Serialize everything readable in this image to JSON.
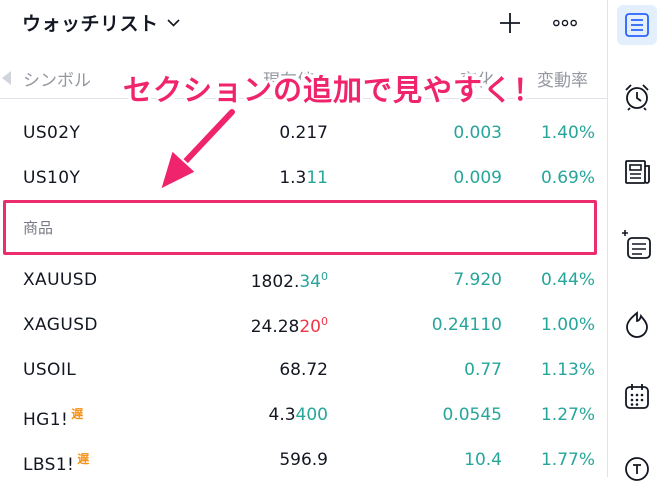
{
  "header": {
    "title": "ウォッチリスト",
    "icons": [
      "chevron-down-icon",
      "plus-icon",
      "more-dots-icon"
    ]
  },
  "columns": {
    "symbol": "シンボル",
    "last": "現在値",
    "change": "変化",
    "change_pct": "変動率"
  },
  "annotation": {
    "callout": "セクションの追加で見やすく！",
    "color": "#f0246c"
  },
  "rows_top": [
    {
      "symbol": "US02Y",
      "last": "0.217",
      "last_hi": "",
      "last_hi_dir": "",
      "last_sup": "",
      "change": "0.003",
      "change_pct": "1.40%"
    },
    {
      "symbol": "US10Y",
      "last": "1.3",
      "last_hi": "11",
      "last_hi_dir": "up",
      "last_sup": "",
      "change": "0.009",
      "change_pct": "0.69%"
    }
  ],
  "section": {
    "label": "商品"
  },
  "rows_bottom": [
    {
      "symbol": "XAUUSD",
      "badge": "",
      "last": "1802.",
      "last_hi": "34",
      "last_hi_dir": "up",
      "last_sup": "0",
      "change": "7.920",
      "change_pct": "0.44%"
    },
    {
      "symbol": "XAGUSD",
      "badge": "",
      "last": "24.28",
      "last_hi": "20",
      "last_hi_dir": "dn",
      "last_sup": "0",
      "change": "0.24110",
      "change_pct": "1.00%"
    },
    {
      "symbol": "USOIL",
      "badge": "",
      "last": "68.72",
      "last_hi": "",
      "last_hi_dir": "",
      "last_sup": "",
      "change": "0.77",
      "change_pct": "1.13%"
    },
    {
      "symbol": "HG1!",
      "badge": "遅",
      "last": "4.3",
      "last_hi": "400",
      "last_hi_dir": "up",
      "last_sup": "",
      "change": "0.0545",
      "change_pct": "1.27%"
    },
    {
      "symbol": "LBS1!",
      "badge": "遅",
      "last": "596.9",
      "last_hi": "",
      "last_hi_dir": "",
      "last_sup": "",
      "change": "10.4",
      "change_pct": "1.77%"
    }
  ],
  "sidebar": {
    "items": [
      "watchlist-icon",
      "alarm-clock-icon",
      "news-icon",
      "data-window-icon",
      "hotlist-icon",
      "calendar-icon",
      "ideas-icon"
    ],
    "active": "watchlist-icon",
    "accent": "#2962ff"
  },
  "colors": {
    "up": "#26a69a",
    "down": "#f23645",
    "badge": "#f7931a",
    "highlight": "#ec2d6c"
  }
}
